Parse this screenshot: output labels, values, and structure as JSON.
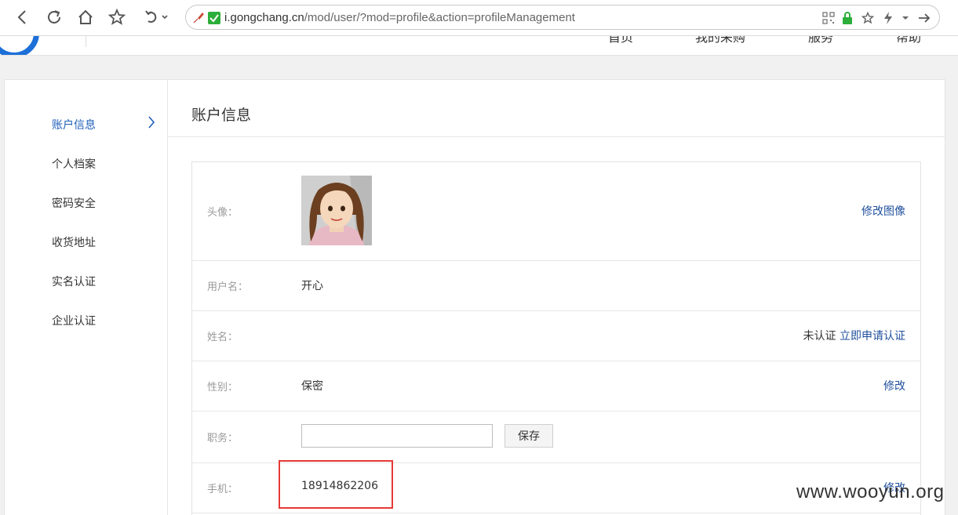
{
  "browser": {
    "url_host": "i.gongchang.cn",
    "url_path": "/mod/user/?mod=profile&action=profileManagement"
  },
  "site_nav": [
    "首页",
    "我的采购",
    "服务",
    "帮助"
  ],
  "sidebar": {
    "items": [
      {
        "label": "账户信息",
        "active": true
      },
      {
        "label": "个人档案"
      },
      {
        "label": "密码安全"
      },
      {
        "label": "收货地址"
      },
      {
        "label": "实名认证"
      },
      {
        "label": "企业认证"
      }
    ]
  },
  "main": {
    "title": "账户信息",
    "rows": {
      "avatar": {
        "label": "头像：",
        "action": "修改图像"
      },
      "username": {
        "label": "用户名：",
        "value": "开心"
      },
      "name": {
        "label": "姓名：",
        "status": "未认证",
        "action": "立即申请认证"
      },
      "gender": {
        "label": "性别：",
        "value": "保密",
        "action": "修改"
      },
      "job": {
        "label": "职务：",
        "input_value": "",
        "save_label": "保存"
      },
      "phone": {
        "label": "手机：",
        "value": "18914862206",
        "action": "修改"
      }
    }
  },
  "watermark": "www.wooyun.org",
  "colors": {
    "link": "#1f4f9c",
    "active": "#1f5fb8",
    "highlight": "#e53935",
    "logo": "#1d6fd8"
  }
}
